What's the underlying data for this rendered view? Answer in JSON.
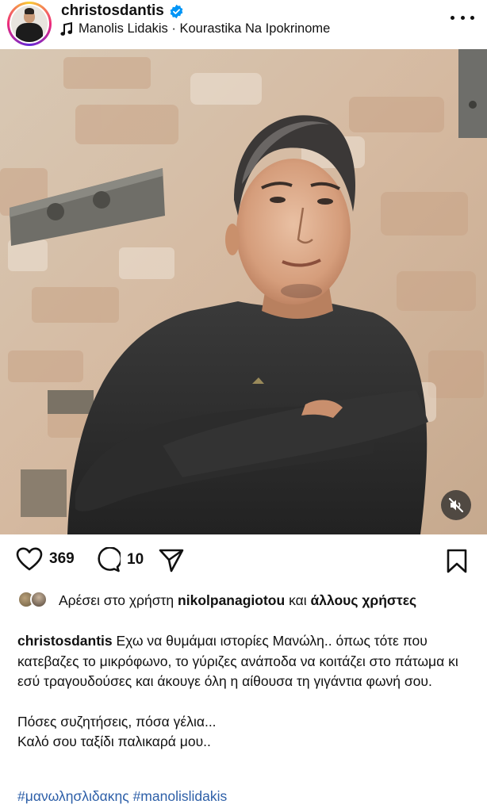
{
  "post": {
    "username": "christosdantis",
    "music": "Manolis Lidakis · Kourastika Na Ipokrinome",
    "likes": "369",
    "comments": "10",
    "liked_by": {
      "prefix": "Αρέσει στο χρήστη",
      "user": "nikolpanagiotou",
      "middle": "και",
      "others": "άλλους χρήστες"
    },
    "caption": {
      "username": "christosdantis",
      "text_1": "Εχω να θυμάμαι ιστορίες Μανώλη.. όπως τότε που κατεβαζες το μικρόφωνο, το γύριζες ανάποδα να κοιτάζει στο πάτωμα κι εσύ τραγουδούσες και άκουγε όλη η αίθουσα τη γιγάντια φωνή σου.",
      "text_2": "Πόσες συζητήσεις, πόσα γέλια...",
      "text_3": "Καλό σου ταξίδι παλικαρά μου..",
      "hashtags": "#μανωλησλιδακης #manolislidakis"
    }
  },
  "icons": {
    "verified": "verified-badge-icon",
    "music": "music-note-icon",
    "more": "more-options-icon",
    "like": "heart-icon",
    "comment": "comment-bubble-icon",
    "share": "paper-plane-icon",
    "save": "bookmark-icon",
    "mute": "speaker-muted-icon"
  },
  "colors": {
    "verified_blue": "#0095f6",
    "hashtag_blue": "#2d5fa8"
  }
}
